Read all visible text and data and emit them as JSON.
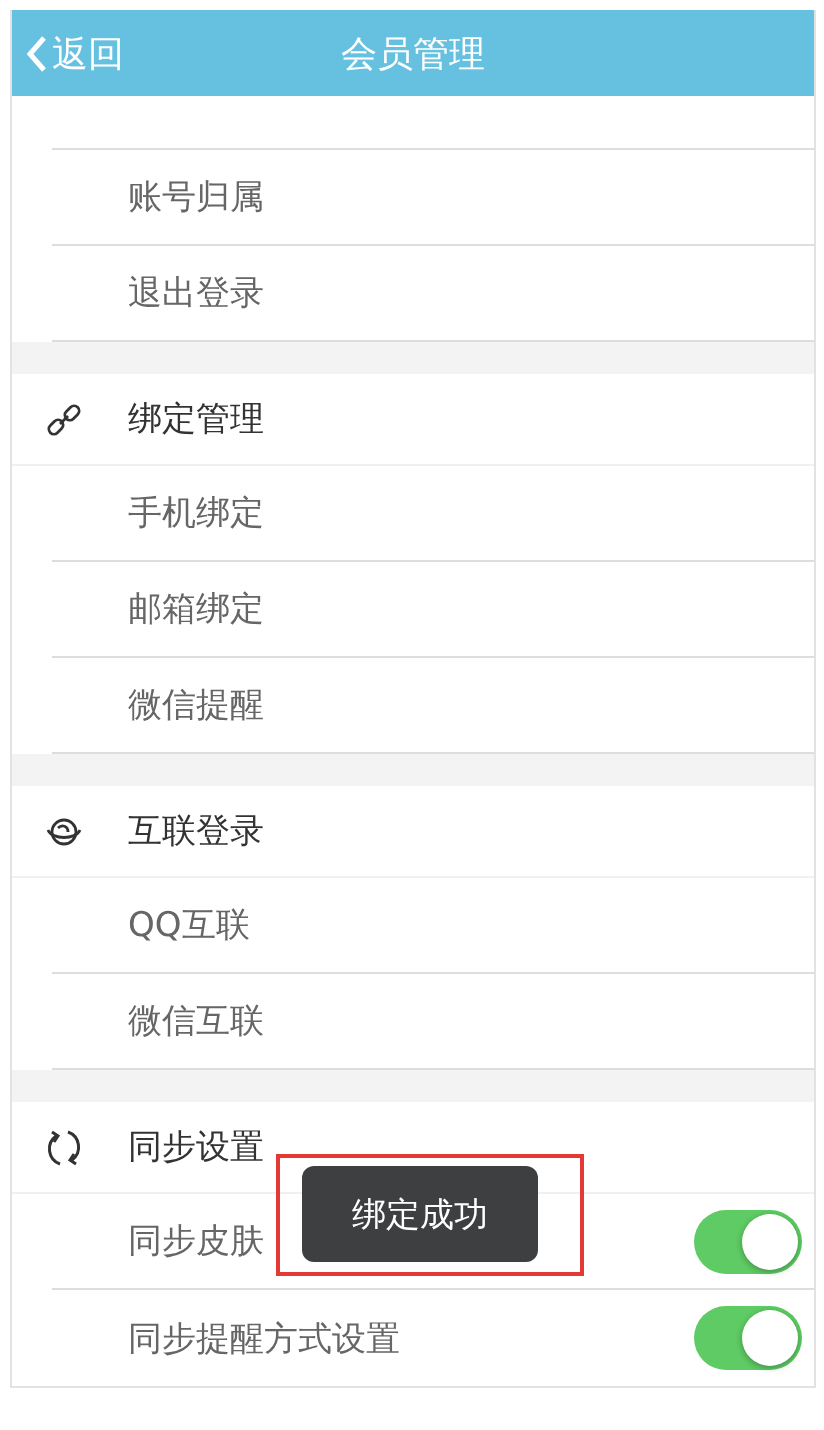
{
  "header": {
    "back": "返回",
    "title": "会员管理"
  },
  "sections": [
    {
      "items": [
        {
          "kind": "item",
          "label": "账号归属"
        },
        {
          "kind": "item",
          "label": "退出登录"
        }
      ]
    },
    {
      "title": "绑定管理",
      "kind": "link",
      "items": [
        {
          "kind": "item",
          "label": "手机绑定"
        },
        {
          "kind": "item",
          "label": "邮箱绑定"
        },
        {
          "kind": "item",
          "label": "微信提醒"
        }
      ]
    },
    {
      "title": "互联登录",
      "kind": "globe",
      "items": [
        {
          "kind": "item",
          "label": "QQ互联"
        },
        {
          "kind": "item",
          "label": "微信互联"
        }
      ]
    },
    {
      "title": "同步设置",
      "kind": "sync",
      "items": [
        {
          "kind": "toggle",
          "label": "同步皮肤",
          "on": true
        },
        {
          "kind": "toggle",
          "label": "同步提醒方式设置",
          "on": true
        }
      ]
    }
  ],
  "toast": {
    "text": "绑定成功",
    "highlighted": true
  }
}
